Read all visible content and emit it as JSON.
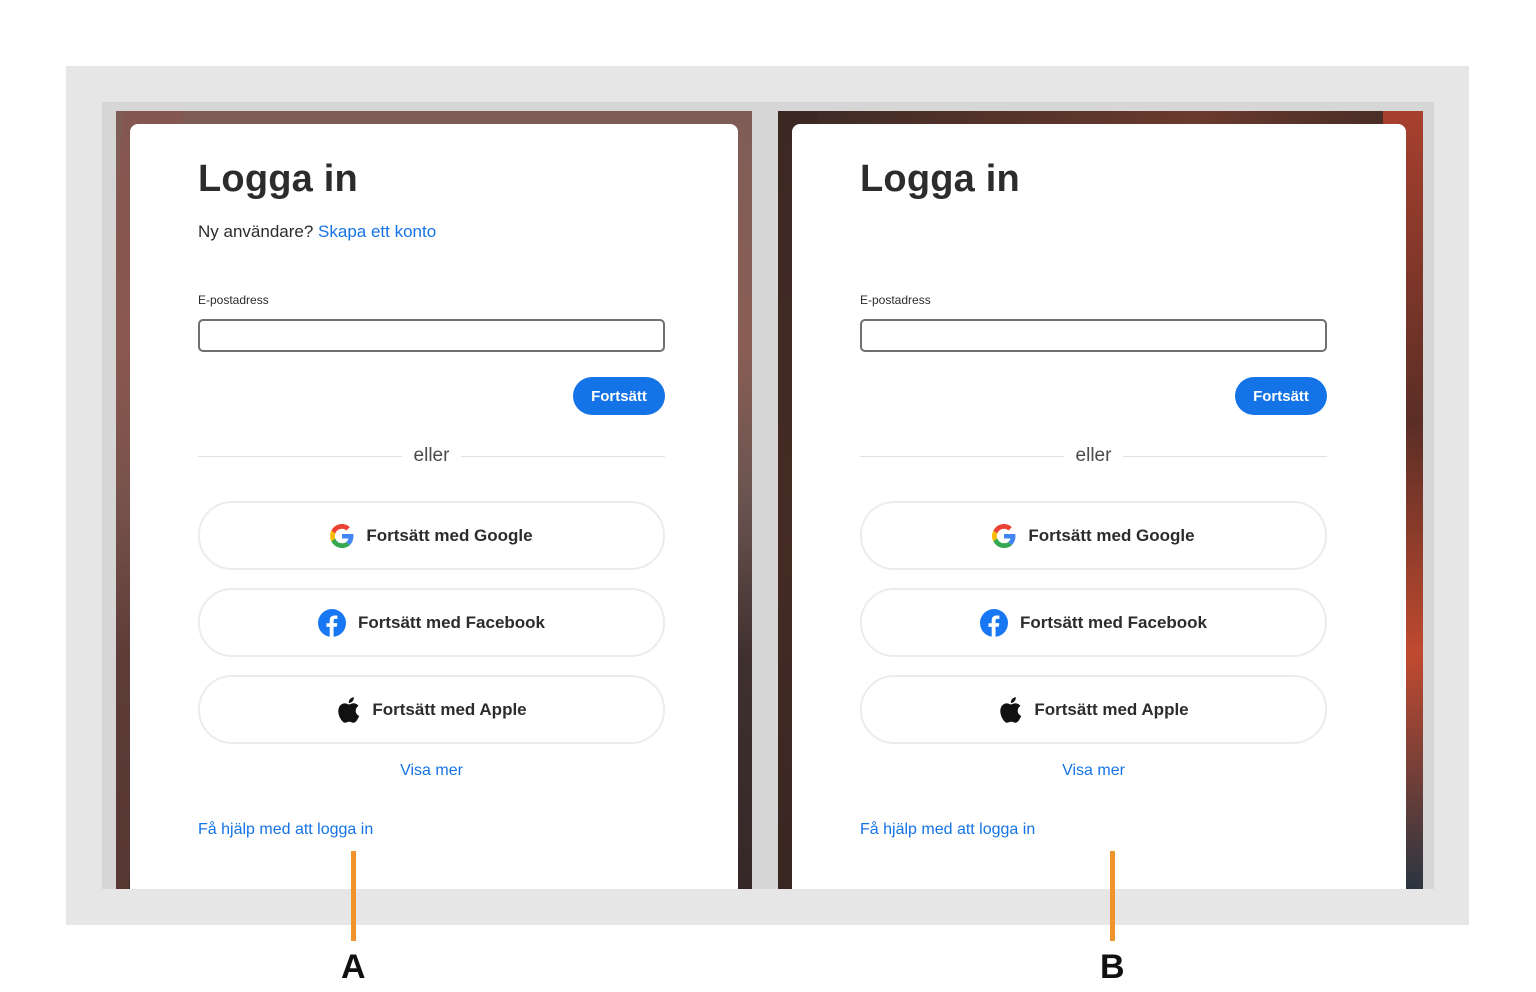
{
  "panels": [
    {
      "id": "A",
      "title": "Logga in",
      "new_user_text": "Ny användare?",
      "create_account_link": "Skapa ett konto",
      "email_label": "E-postadress",
      "email_value": "",
      "continue_label": "Fortsätt",
      "or_text": "eller",
      "google_label": "Fortsätt med Google",
      "facebook_label": "Fortsätt med Facebook",
      "apple_label": "Fortsätt med Apple",
      "show_more": "Visa mer",
      "help_link": "Få hjälp med att logga in"
    },
    {
      "id": "B",
      "title": "Logga in",
      "email_label": "E-postadress",
      "email_value": "",
      "continue_label": "Fortsätt",
      "or_text": "eller",
      "google_label": "Fortsätt med Google",
      "facebook_label": "Fortsätt med Facebook",
      "apple_label": "Fortsätt med Apple",
      "show_more": "Visa mer",
      "help_link": "Få hjälp med att logga in"
    }
  ],
  "markers": {
    "a": "A",
    "b": "B"
  },
  "icons": {
    "google": "google-icon",
    "facebook": "facebook-icon",
    "apple": "apple-icon"
  },
  "colors": {
    "accent": "#1473e6",
    "marker": "#f0932b",
    "facebook": "#1877f2"
  }
}
